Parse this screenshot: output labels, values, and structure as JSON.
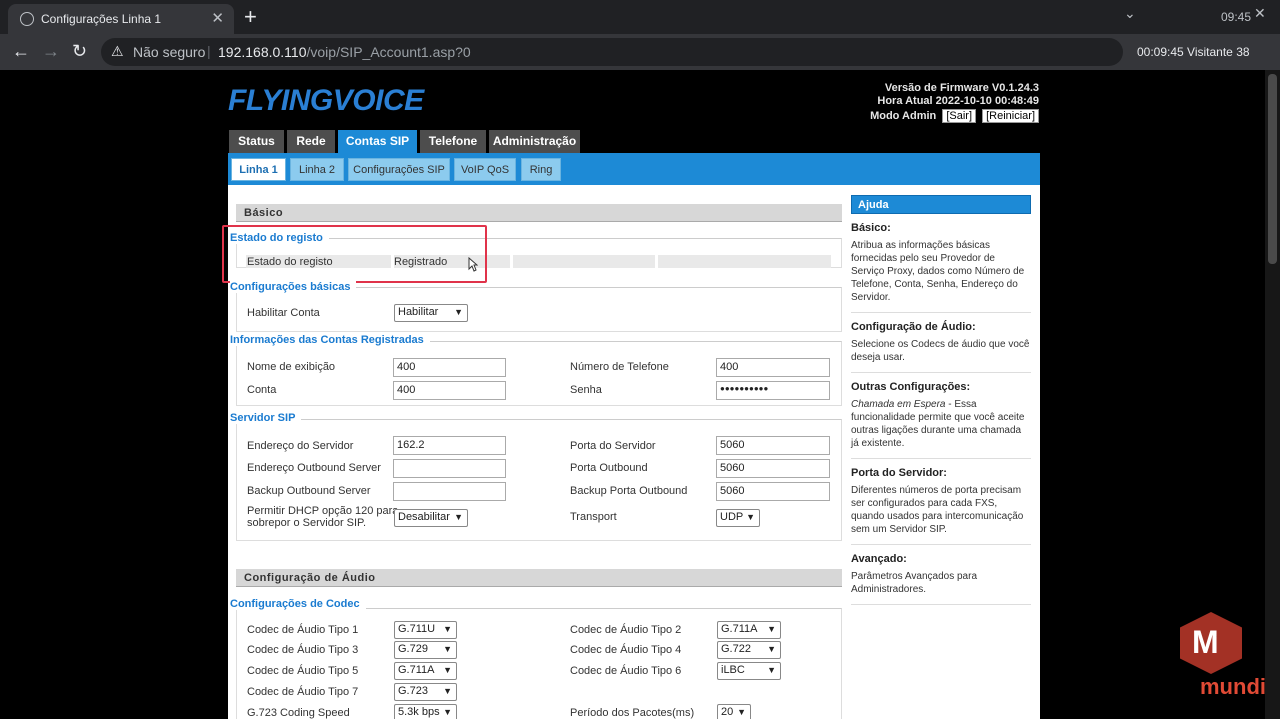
{
  "browser": {
    "tab_title": "Configurações Linha 1",
    "tab_close": "✕",
    "new_tab": "+",
    "clock_top": "09:45",
    "address_warning": "Não seguro",
    "address_host": "192.168.0.110",
    "address_path": "/voip/SIP_Account1.asp?0",
    "extension_text": "00:09:45 Visitante 38"
  },
  "header": {
    "logo": "FLYINGVOICE",
    "firmware": "Versão de Firmware V0.1.24.3",
    "time": "Hora Atual 2022-10-10 00:48:49",
    "mode": "Modo Admin",
    "logout": "[Sair]",
    "reboot": "[Reiniciar]"
  },
  "main_tabs": [
    "Status",
    "Rede",
    "Contas SIP",
    "Telefone",
    "Administração"
  ],
  "sub_tabs": [
    "Linha 1",
    "Linha 2",
    "Configurações SIP",
    "VoIP QoS",
    "Ring"
  ],
  "basic": {
    "section": "Básico",
    "reg_group": "Estado do registo",
    "reg_label": "Estado do registo",
    "reg_value": "Registrado",
    "cfg_group": "Configurações básicas",
    "enable_label": "Habilitar Conta",
    "enable_value": "Habilitar",
    "acc_group": "Informações das Contas Registradas",
    "display_name_label": "Nome de exibição",
    "display_name_value": "400",
    "phone_label": "Número de Telefone",
    "phone_value": "400",
    "account_label": "Conta",
    "account_value": "400",
    "password_label": "Senha",
    "password_value": "●●●●●●●●●●",
    "sip_group": "Servidor SIP",
    "server_addr_label": "Endereço do Servidor",
    "server_addr_value": "162.2",
    "server_port_label": "Porta do Servidor",
    "server_port_value": "5060",
    "outbound_addr_label": "Endereço Outbound Server",
    "outbound_addr_value": "",
    "outbound_port_label": "Porta Outbound",
    "outbound_port_value": "5060",
    "backup_outbound_label": "Backup Outbound Server",
    "backup_outbound_value": "",
    "backup_port_label": "Backup Porta Outbound",
    "backup_port_value": "5060",
    "dhcp_label_1": "Permitir DHCP opção 120 para",
    "dhcp_label_2": "sobrepor o Servidor SIP.",
    "dhcp_value": "Desabilitar",
    "transport_label": "Transport",
    "transport_value": "UDP"
  },
  "audio": {
    "section": "Configuração de Áudio",
    "codec_group": "Configurações de Codec",
    "codecs": [
      {
        "label": "Codec de Áudio Tipo 1",
        "value": "G.711U"
      },
      {
        "label": "Codec de Áudio Tipo 2",
        "value": "G.711A"
      },
      {
        "label": "Codec de Áudio Tipo 3",
        "value": "G.729"
      },
      {
        "label": "Codec de Áudio Tipo 4",
        "value": "G.722"
      },
      {
        "label": "Codec de Áudio Tipo 5",
        "value": "G.711A"
      },
      {
        "label": "Codec de Áudio Tipo 6",
        "value": "iLBC"
      },
      {
        "label": "Codec de Áudio Tipo 7",
        "value": "G.723"
      }
    ],
    "coding_speed_label": "G.723 Coding Speed",
    "coding_speed_value": "5.3k bps",
    "packet_period_label": "Período dos Pacotes(ms)",
    "packet_period_value": "20"
  },
  "help": {
    "title": "Ajuda",
    "sections": [
      {
        "title": "Básico:",
        "text": "Atribua as informações básicas fornecidas pelo seu Provedor de Serviço Proxy, dados como Número de Telefone, Conta, Senha, Endereço do Servidor."
      },
      {
        "title": "Configuração de Áudio:",
        "text": "Selecione os Codecs de áudio que você deseja usar."
      },
      {
        "title": "Outras Configurações:",
        "italic": "Chamada em Espera",
        "text": " - Essa funcionalidade permite que você aceite outras ligações durante uma chamada já existente."
      },
      {
        "title": "Porta do Servidor:",
        "text": "Diferentes números de porta precisam ser configurados para cada FXS, quando usados para intercomunicação sem um Servidor SIP."
      },
      {
        "title": "Avançado:",
        "text": "Parâmetros Avançados para Administradores."
      }
    ]
  },
  "watermark": {
    "text": "mundi",
    "glyph": "M"
  }
}
